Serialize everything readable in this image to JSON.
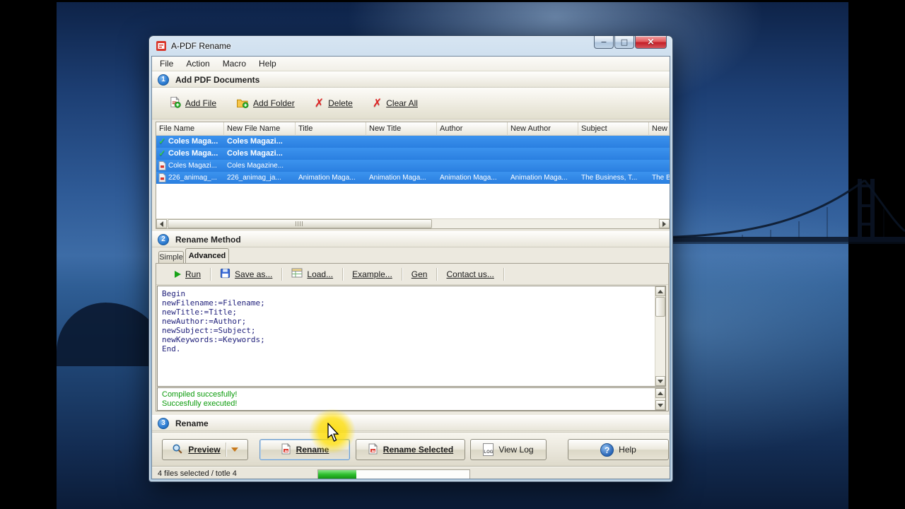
{
  "window": {
    "title": "A-PDF Rename",
    "controls": {
      "minimize": "−",
      "maximize": "□",
      "close": "×"
    }
  },
  "menu": {
    "items": [
      "File",
      "Action",
      "Macro",
      "Help"
    ]
  },
  "step1": {
    "badge": "1",
    "title": "Add PDF Documents",
    "toolbar": {
      "add_file": "Add File",
      "add_folder": "Add Folder",
      "delete": "Delete",
      "clear_all": "Clear All"
    },
    "table": {
      "columns": [
        "File Name",
        "New File Name",
        "Title",
        "New Title",
        "Author",
        "New Author",
        "Subject",
        "New S"
      ],
      "rows": [
        {
          "cells": [
            "Coles Maga...",
            "Coles Magazi..."
          ]
        },
        {
          "cells": [
            "Coles Maga...",
            "Coles Magazi..."
          ]
        },
        {
          "cells": [
            "Coles Magazi...",
            "Coles Magazine..."
          ]
        },
        {
          "cells": [
            "226_animag_...",
            "226_animag_ja...",
            "Animation Maga...",
            "Animation Maga...",
            "Animation Maga...",
            "Animation Maga...",
            "The Business, T...",
            "The Bu..."
          ]
        }
      ]
    }
  },
  "step2": {
    "badge": "2",
    "title": "Rename Method",
    "tabs": {
      "simple": "Simple",
      "advanced": "Advanced"
    },
    "toolbar": {
      "run": "Run",
      "save_as": "Save as...",
      "load": "Load...",
      "example": "Example...",
      "gen": "Gen",
      "contact_us": "Contact us..."
    },
    "script_lines": [
      "Begin",
      "newFilename:=Filename;",
      "newTitle:=Title;",
      "newAuthor:=Author;",
      "newSubject:=Subject;",
      "newKeywords:=Keywords;",
      "End."
    ],
    "status_lines": [
      "Compiled succesfully!",
      "Succesfully executed!"
    ]
  },
  "step3": {
    "badge": "3",
    "title": "Rename",
    "buttons": {
      "preview": "Preview",
      "rename": "Rename",
      "rename_selected": "Rename Selected",
      "view_log": "View Log",
      "help": "Help"
    },
    "view_log_icon_text": "LOG",
    "help_glyph": "?"
  },
  "statusbar": {
    "text": "4 files selected / totle 4"
  },
  "icons": {
    "check": "✓",
    "red_x": "✗"
  },
  "colors": {
    "selection_blue": "#2e87e8",
    "success_green": "#0b9b0b",
    "highlight_yellow": "#ffde00",
    "close_red": "#c41f27",
    "badge_blue": "#2d7cd2",
    "progress_green": "#2fbf2f"
  }
}
